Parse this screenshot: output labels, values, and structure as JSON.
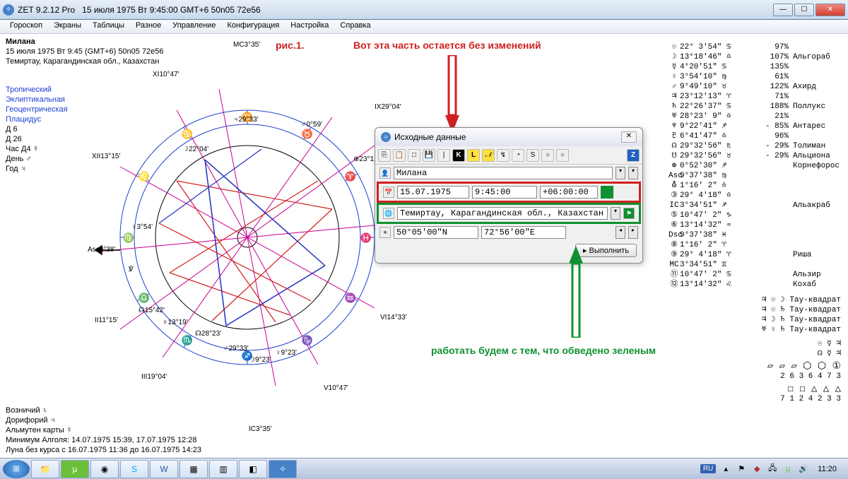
{
  "titlebar": {
    "app": "ZET 9.2.12 Pro",
    "date": "15 июля 1975  Вт   9:45:00 GMT+6 50n05  72e56"
  },
  "menu": [
    "Гороскоп",
    "Экраны",
    "Таблицы",
    "Разное",
    "Управление",
    "Конфигурация",
    "Настройка",
    "Справка"
  ],
  "leftinfo": {
    "name": "Милана",
    "line2": "15 июля 1975  Вт   9:45  (GMT+6) 50n05  72e56",
    "line3": "Темиртау, Карагандинская обл., Казахстан",
    "set1": "Тропический",
    "set2": "Эклиптикальная",
    "set3": "Геоцентрическая",
    "set4": "Плацидус",
    "d_lbl": "Д  6",
    "d_lbl2": "Д  26",
    "chas": "Час Д4 ☿",
    "den": "День  ♂",
    "god": "Год   ♃"
  },
  "fig": "рис.1.",
  "anno_red": "Вот эта часть остается без изменений",
  "anno_green": "работать будем с тем, что обведено зеленым",
  "dialog": {
    "title": "Исходные данные",
    "name": "Милана",
    "date": "15.07.1975",
    "time": "9:45:00",
    "tz": "+06:00:00",
    "place": "Темиртау, Карагандинская обл., Казахстан",
    "lat": "50°05'00\"N",
    "lon": "72°56'00\"E",
    "exec": "Выполнить"
  },
  "labels": {
    "mc": "MC3°35'",
    "xi": "XI10°47'",
    "ix": "IX29°04'",
    "xii": "XII13°15'",
    "d2204": "☽22°04'",
    "cz354": "♀3°54'",
    "ii": "II11°15'",
    "asc": "Asc9°38'",
    "vp": "℣",
    "node2823": "☊28°23'",
    "iiib": "III19°04'",
    "rahu1542": "☊15°42'",
    "nep1319": "♆13°19'",
    "mars": "♂29°33'",
    "moon923": "☽9°23'",
    "ic": "IC3°35'",
    "ven923": "♀9°23'",
    "v": "V10°47'",
    "vi": "VI14°33'",
    "d2933": "♃29°33'",
    "fort2312": "⊕23°12'",
    "mars059": "♂0°59'"
  },
  "right": [
    {
      "s": "☉",
      "p": "22° 3'54\" ♋",
      "pc": "97%",
      "st": ""
    },
    {
      "s": "☽",
      "p": "13°18'46\" ♎",
      "pc": "107%",
      "st": "Альгораб"
    },
    {
      "s": "☿",
      "p": " 4°20'51\" ♋",
      "pc": "135%",
      "st": ""
    },
    {
      "s": "♀",
      "p": " 3°54'10\" ♍",
      "pc": "61%",
      "st": ""
    },
    {
      "s": "♂",
      "p": " 9°49'10\" ♉",
      "pc": "122%",
      "st": "Ахирд"
    },
    {
      "s": "♃",
      "p": "23°12'13\" ♈",
      "pc": "71%",
      "st": ""
    },
    {
      "s": "♄",
      "p": "22°26'37\" ♋",
      "pc": "188%",
      "st": "Поллукс"
    },
    {
      "s": "♅",
      "p": "28°23' 9\" ♎",
      "pc": "21%",
      "st": ""
    },
    {
      "s": "♆",
      "p": " 9°22'41\" ♐",
      "pc": "- 85%",
      "st": "Антарес"
    },
    {
      "s": "♇",
      "p": " 6°41'47\" ♎",
      "pc": "96%",
      "st": ""
    },
    {
      "s": "☊",
      "p": "29°32'56\" ♏",
      "pc": "- 29%",
      "st": "Толиман"
    },
    {
      "s": "☋",
      "p": "29°32'56\" ♉",
      "pc": "- 29%",
      "st": "Альциона"
    },
    {
      "s": "⊛",
      "p": " 0°52'30\" ♐",
      "pc": "",
      "st": "Корнефорос"
    },
    {
      "s": "Asc",
      "p": " 9°37'38\" ♍",
      "pc": "",
      "st": ""
    },
    {
      "s": "⛢",
      "p": " 1°16' 2\" ♎",
      "pc": "",
      "st": ""
    },
    {
      "s": "③",
      "p": "29° 4'18\" ♎",
      "pc": "",
      "st": ""
    },
    {
      "s": "IC",
      "p": " 3°34'51\" ♐",
      "pc": "",
      "st": "Альакраб"
    },
    {
      "s": "⑤",
      "p": "10°47' 2\" ♑",
      "pc": "",
      "st": ""
    },
    {
      "s": "⑥",
      "p": "13°14'32\" ♒",
      "pc": "",
      "st": ""
    },
    {
      "s": "Dsc",
      "p": " 9°37'38\" ♓",
      "pc": "",
      "st": ""
    },
    {
      "s": "⑧",
      "p": " 1°16' 2\" ♈",
      "pc": "",
      "st": ""
    },
    {
      "s": "⑨",
      "p": "29° 4'18\" ♈",
      "pc": "",
      "st": "Риша"
    },
    {
      "s": "MC",
      "p": " 3°34'51\" ♊",
      "pc": "",
      "st": ""
    },
    {
      "s": "⑪",
      "p": "10°47' 2\" ♋",
      "pc": "",
      "st": "Альзир"
    },
    {
      "s": "⑫",
      "p": "13°14'32\" ♌",
      "pc": "",
      "st": "Кохаб"
    }
  ],
  "aspects": [
    "♃ ☉ ☽  Тау-квадрат",
    "♃ ☉ ♄  Тау-квадрат",
    "♃ ☽ ♄  Тау-квадрат",
    "♅ ♀ ♄  Тау-квадрат"
  ],
  "sym_row1": "☉ ☿ ♃",
  "sym_row2": "☊ ☿ ♃",
  "shapes1": "▱ ▱ ▱    ⬡ ⬡ ①",
  "nums1": "2  6  3      6  4  7  3",
  "shapes2": "☐ ☐      △ △ △",
  "nums2": "7  1  2      4  2  3  3",
  "bottom": {
    "l1": "Возничий ♄",
    "l2": "Дорифорий ♃",
    "l3": "Альмутен карты ☿",
    "l4": "Минимум Алголя: 14.07.1975 15:39,  17.07.1975 12:28",
    "l5": "Луна без курса с 16.07.1975 11:36 до 16.07.1975 14:23"
  },
  "tray": {
    "lang": "RU",
    "time": "11:20"
  }
}
